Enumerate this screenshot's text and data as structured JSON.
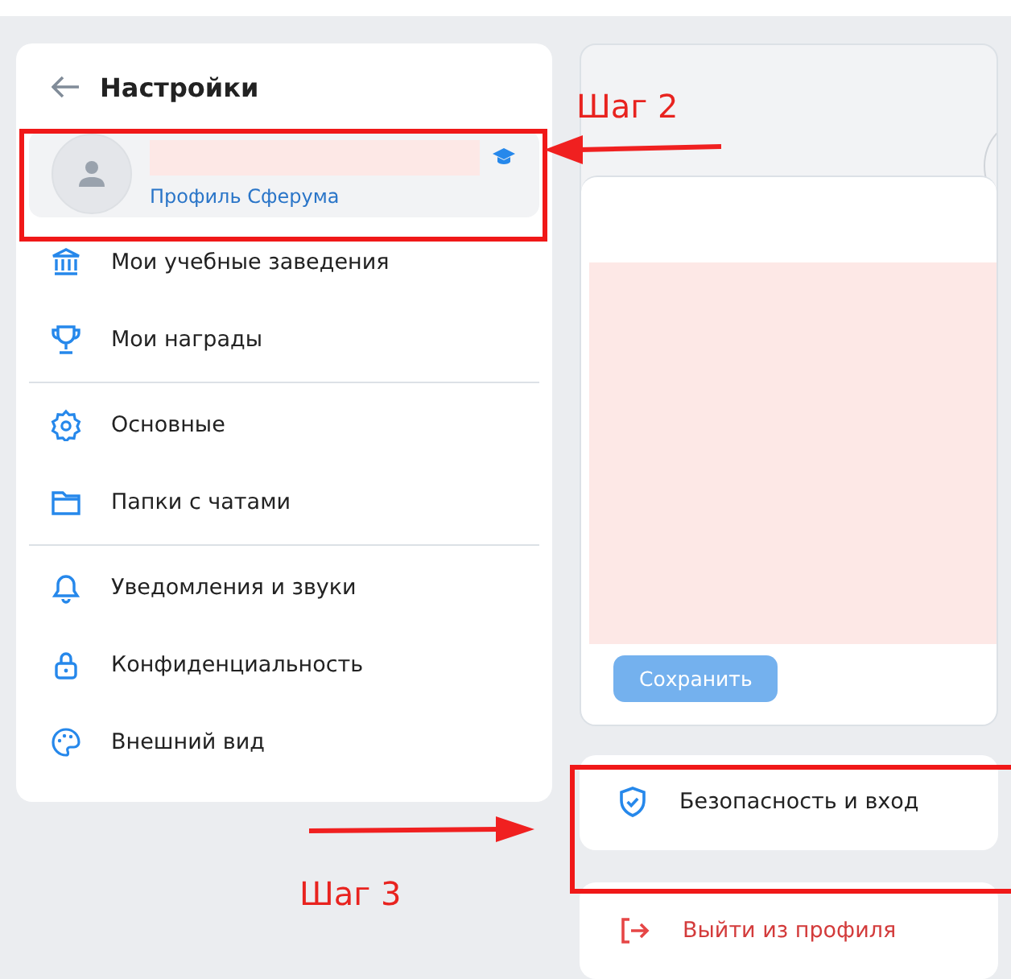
{
  "settings": {
    "title": "Настройки",
    "profile": {
      "subtitle": "Профиль Сферума"
    },
    "groups": [
      [
        {
          "label": "Мои учебные заведения"
        },
        {
          "label": "Мои награды"
        }
      ],
      [
        {
          "label": "Основные"
        },
        {
          "label": "Папки с чатами"
        }
      ],
      [
        {
          "label": "Уведомления и звуки"
        },
        {
          "label": "Конфиденциальность"
        },
        {
          "label": "Внешний вид"
        }
      ]
    ]
  },
  "profile_editor": {
    "save_button": {
      "label": "Сохранить",
      "disabled": true
    }
  },
  "security_item": {
    "label": "Безопасность и вход"
  },
  "logout_item": {
    "label": "Выйти из профиля"
  },
  "annotations": [
    {
      "label": "Шаг 2"
    },
    {
      "label": "Шаг 3"
    }
  ]
}
